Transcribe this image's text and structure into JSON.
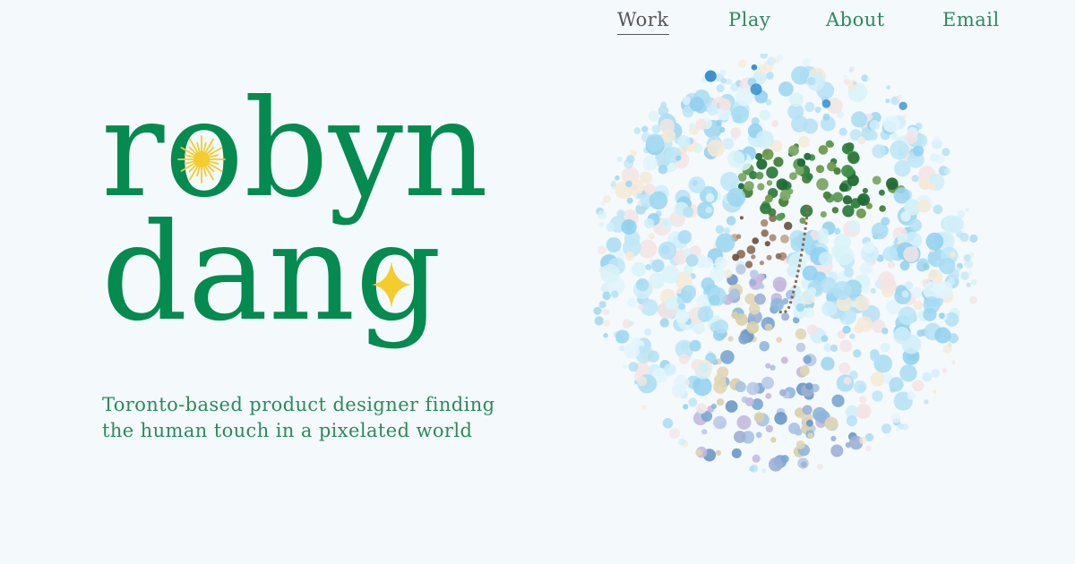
{
  "nav": {
    "items": [
      {
        "label": "Work",
        "active": true
      },
      {
        "label": "Play",
        "active": false
      },
      {
        "label": "About",
        "active": false
      },
      {
        "label": "Email",
        "active": false
      }
    ]
  },
  "hero": {
    "name_line1": "robyn",
    "name_line2": "dang",
    "tagline_line1": "Toronto-based product designer finding",
    "tagline_line2": "the human touch in a pixelated world"
  },
  "portrait": {
    "icon": "pointillist-self-portrait-with-umbrella"
  },
  "icons": {
    "sun": "sun-icon",
    "sparkle": "sparkle-icon"
  },
  "colors": {
    "background": "#f4f9fc",
    "brand_green": "#058a4f",
    "nav_active": "#555555",
    "accent_yellow": "#f4cc2e",
    "tagline_green": "#2c8a5c"
  }
}
